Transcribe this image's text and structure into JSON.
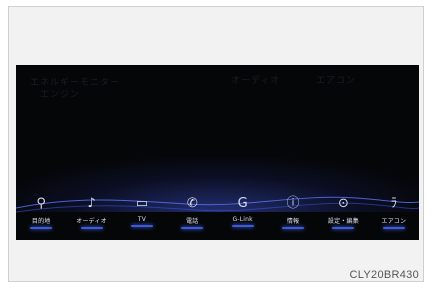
{
  "screen": {
    "menu": [
      {
        "icon": "map-pin-icon",
        "glyph": "⚲",
        "label": "目的地"
      },
      {
        "icon": "music-note-icon",
        "glyph": "♪",
        "label": "オーディオ"
      },
      {
        "icon": "tv-icon",
        "glyph": "▭",
        "label": "TV"
      },
      {
        "icon": "phone-icon",
        "glyph": "✆",
        "label": "電話"
      },
      {
        "icon": "g-link-icon",
        "glyph": "G",
        "label": "G-Link"
      },
      {
        "icon": "info-icon",
        "glyph": "ⓘ",
        "label": "情報"
      },
      {
        "icon": "settings-icon",
        "glyph": "⊙",
        "label": "設定・編集"
      },
      {
        "icon": "air-conditioner-icon",
        "glyph": "ﾗ",
        "label": "エアコン"
      }
    ],
    "colors": {
      "background": "#050608",
      "accent": "#3b5bd9",
      "label": "#dfe3f2"
    }
  },
  "caption": "CLY20BR430"
}
